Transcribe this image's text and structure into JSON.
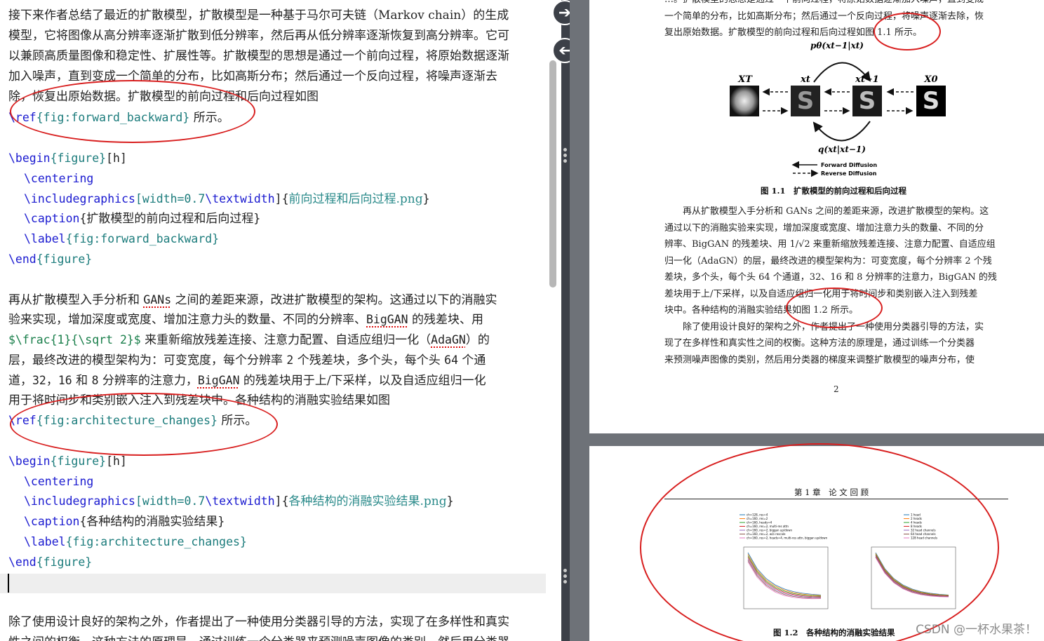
{
  "editor": {
    "lines": [
      [
        "接下来作者总结了最近的扩散模型，扩散模型是一种基于马尔可夫链（Markov chain）的生成"
      ],
      [
        "模型，它将图像从高分辨率逐渐扩散到低分辨率，然后再从低分辨率逐渐恢复到高分辨率。它可"
      ],
      [
        "以兼顾高质量图像和稳定性、扩展性等。扩散模型的思想是通过一个前向过程，将原始数据逐渐"
      ],
      [
        "加入噪声，直到变成一个简单的分布，比如高斯分布；然后通过一个反向过程，将噪声逐渐去"
      ],
      [
        "除，恢复出原始数据。扩散模型的前向过程和后向过程如图"
      ],
      [
        "\\ref",
        "{fig:forward_backward}",
        " 所示。"
      ],
      [],
      [
        "\\begin",
        "{figure}",
        "[h]"
      ],
      [
        "\\centering"
      ],
      [
        "\\includegraphics",
        "[width=0.7",
        "\\textwidth",
        "]{",
        "前向过程和后向过程.png",
        "}"
      ],
      [
        "\\caption",
        "{",
        "扩散模型的前向过程和后向过程",
        "}"
      ],
      [
        "\\label",
        "{fig:forward_backward}"
      ],
      [
        "\\end",
        "{figure}"
      ],
      [],
      [
        "再从扩散模型入手分析和 ",
        "GANs",
        " 之间的差距来源，改进扩散模型的架构。这通过以下的消融实"
      ],
      [
        "验来实现，增加深度或宽度、增加注意力头的数量、不同的分辨率、",
        "BigGAN",
        " 的残差块、用"
      ],
      [
        "$\\frac{1}{\\sqrt 2}$",
        " 来重新缩放残差连接、注意力配置、自适应组归一化（",
        "AdaGN",
        "）的"
      ],
      [
        "层，最终改进的模型架构为：可变宽度，每个分辨率 ",
        "2",
        " 个残差块，多个头，每个头 ",
        "64",
        " 个通"
      ],
      [
        "道，",
        "32",
        "，",
        "16",
        " 和 ",
        "8",
        " 分辨率的注意力，",
        "BigGAN",
        " 的残差块用于上/下采样，以及自适应组归一化"
      ],
      [
        "用于将时间步和类别嵌入注入到残差块中。各种结构的消融实验结果如图"
      ],
      [
        "\\ref",
        "{fig:architecture_changes}",
        " 所示。"
      ],
      [],
      [
        "\\begin",
        "{figure}",
        "[h]"
      ],
      [
        "\\centering"
      ],
      [
        "\\includegraphics",
        "[width=0.7",
        "\\textwidth",
        "]{",
        "各种结构的消融实验结果.png",
        "}"
      ],
      [
        "\\caption",
        "{",
        "各种结构的消融实验结果",
        "}"
      ],
      [
        "\\label",
        "{fig:architecture_changes}"
      ],
      [
        "\\end",
        "{figure}"
      ],
      [],
      [],
      [
        "除了使用设计良好的架构之外，作者提出了一种使用分类器引导的方法，实现了在多样性和真实"
      ],
      [
        "性之间的权衡。这种方法的原理是，通过训练一个分类器来预测噪声图像的类别，然后用分类器"
      ]
    ]
  },
  "viewer": {
    "page1_top_lines": [
      "…。扩散模型的思想是通过一个前向过程，将原始数据逐渐加入噪声，直到变成",
      "一个简单的分布，比如高斯分布；然后通过一个反向过程，将噪声逐渐去除，恢",
      "复出原始数据。扩散模型的前向过程和后向过程如图 1.1 所示。"
    ],
    "figure1": {
      "p_label": "pθ(xt−1|xt)",
      "q_label": "q(xt|xt−1)",
      "node_labels": [
        "XT",
        "xt",
        "xt−1",
        "X0"
      ],
      "legend": [
        "Forward Diffusion",
        "Reverse Diffusion"
      ],
      "caption": "图 1.1　扩散模型的前向过程和后向过程"
    },
    "page1_body_lines": [
      "　　再从扩散模型入手分析和 GANs 之间的差距来源，改进扩散模型的架构。这",
      "通过以下的消融实验来实现，增加深度或宽度、增加注意力头的数量、不同的分",
      "辨率、BigGAN 的残差块、用 1/√2 来重新缩放残差连接、注意力配置、自适应组",
      "归一化（AdaGN）的层，最终改进的模型架构为：可变宽度，每个分辨率 2 个残",
      "差块，多个头，每个头 64 个通道，32、16 和 8 分辨率的注意力，BigGAN 的残",
      "差块用于上/下采样，以及自适应组归一化用于将时间步和类别嵌入注入到残差",
      "块中。各种结构的消融实验结果如图 1.2 所示。",
      "　　除了使用设计良好的架构之外，作者提出了一种使用分类器引导的方法，实",
      "现了在多样性和真实性之间的权衡。这种方法的原理是，通过训练一个分类器",
      "来预测噪声图像的类别，然后用分类器的梯度来调整扩散模型的噪声分布，使"
    ],
    "page_number": "2",
    "page2_header": "第 1 章　论 文 回 顾",
    "figure2_caption": "图 1.2　各种结构的消融实验结果",
    "chart_left_legend": [
      "ch=128, res=4",
      "ch=160, res=2",
      "ch=160, heads=4",
      "ch=160, res=2, multi-res attn",
      "ch=160, res=2, biggan up/down",
      "ch=160, res=2, w/o rescale",
      "ch=160, res=2, heads=4, multi-res attn, biggan up/down"
    ],
    "chart_right_legend": [
      "1 head",
      "2 heads",
      "4 heads",
      "8 heads",
      "32 head channels",
      "64 head channels",
      "128 head channels"
    ]
  },
  "watermark": "CSDN @一杯水果茶！"
}
